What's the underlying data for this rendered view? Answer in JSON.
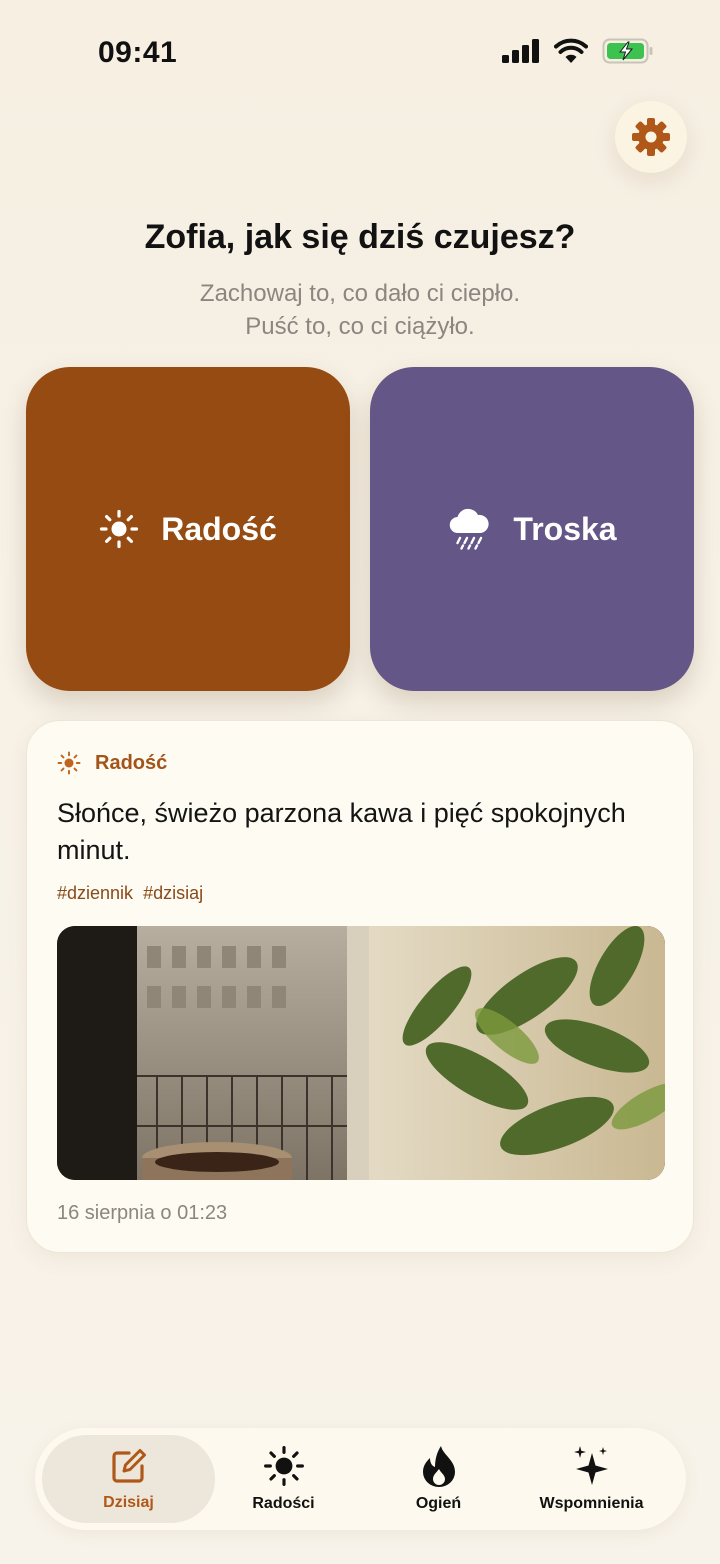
{
  "status_bar": {
    "time": "09:41"
  },
  "header": {
    "title": "Zofia, jak się dziś czujesz?",
    "subtitle_line1": "Zachowaj to, co dało ci ciepło.",
    "subtitle_line2": "Puść to, co ci ciążyło."
  },
  "moods": [
    {
      "label": "Radość",
      "icon": "sun-icon",
      "color": "#954b11"
    },
    {
      "label": "Troska",
      "icon": "rain-cloud-icon",
      "color": "#645687"
    }
  ],
  "entry": {
    "mood_label": "Radość",
    "mood_icon": "sun-icon",
    "text": "Słońce, świeżo parzona kawa i pięć spokojnych minut.",
    "tags": [
      "#dziennik",
      "#dzisiaj"
    ],
    "date": "16 sierpnia o 01:23"
  },
  "tabs": [
    {
      "label": "Dzisiaj",
      "icon": "edit-icon",
      "active": true
    },
    {
      "label": "Radości",
      "icon": "sun-icon",
      "active": false
    },
    {
      "label": "Ogień",
      "icon": "flame-icon",
      "active": false
    },
    {
      "label": "Wspomnienia",
      "icon": "sparkles-icon",
      "active": false
    }
  ],
  "colors": {
    "accent": "#b0581a",
    "joy": "#954b11",
    "worry": "#645687",
    "background": "#f6efe2"
  }
}
